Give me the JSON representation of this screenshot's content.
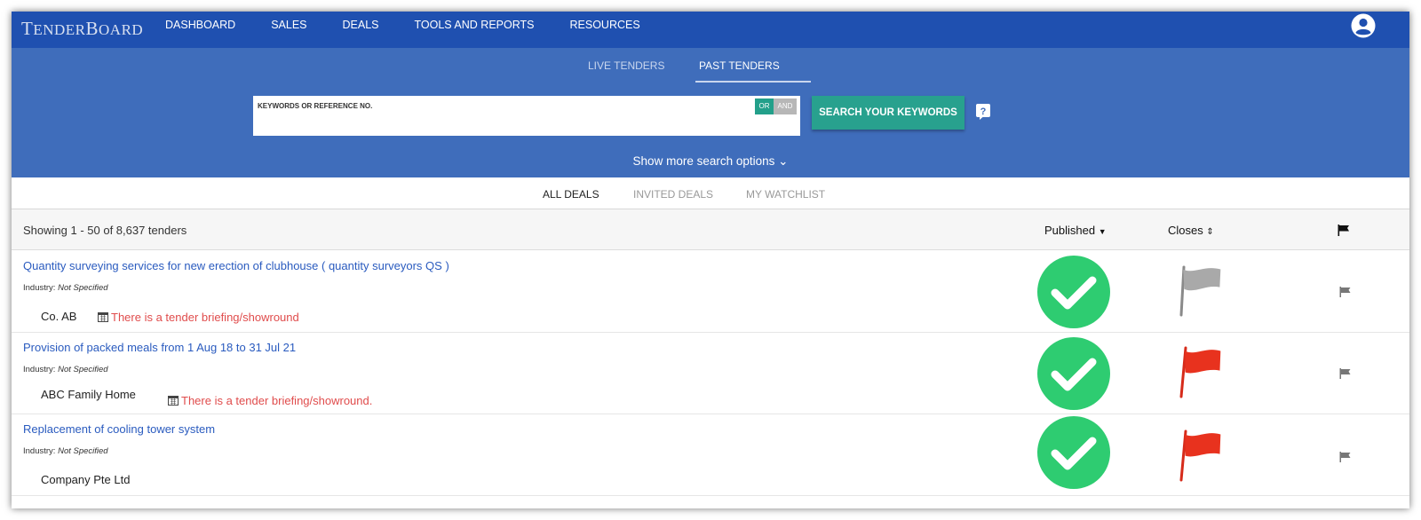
{
  "brand": {
    "logo_first": "T",
    "logo_rest": "ENDER",
    "logo_second": "B",
    "logo_rest2": "OARD"
  },
  "nav": {
    "items": [
      "DASHBOARD",
      "SALES",
      "DEALS",
      "TOOLS AND REPORTS",
      "RESOURCES"
    ]
  },
  "sub_tabs": {
    "live": "LIVE TENDERS",
    "past": "PAST TENDERS",
    "active": "past"
  },
  "search": {
    "label": "KEYWORDS OR REFERENCE NO.",
    "value": "",
    "toggle_or": "OR",
    "toggle_and": "AND",
    "button": "SEARCH YOUR KEYWORDS",
    "more_options": "Show more search options ⌄"
  },
  "deal_tabs": {
    "all": "ALL DEALS",
    "invited": "INVITED DEALS",
    "watchlist": "MY WATCHLIST",
    "active": "all"
  },
  "results": {
    "showing": "Showing 1 - 50 of 8,637 tenders",
    "published_header": "Published",
    "closes_header": "Closes",
    "rows": [
      {
        "title": "Quantity surveying services for new erection of clubhouse ( quantity surveyors QS )",
        "industry_label": "Industry:",
        "industry_value": "Not Specified",
        "company": "Co. AB",
        "briefing": "There is a tender briefing/showround",
        "flag_status": "grey"
      },
      {
        "title": "Provision of packed meals from 1 Aug 18 to 31 Jul 21",
        "industry_label": "Industry:",
        "industry_value": "Not Specified",
        "company": "ABC Family Home",
        "briefing": "There is a tender briefing/showround.",
        "flag_status": "red"
      },
      {
        "title": "Replacement of cooling tower system",
        "industry_label": "Industry:",
        "industry_value": "Not Specified",
        "company": "Company Pte Ltd",
        "briefing": "",
        "flag_status": "red"
      }
    ]
  },
  "colors": {
    "nav_bg": "#1f50b0",
    "band_bg": "#3f6dbb",
    "accent_teal": "#28a18e",
    "link_blue": "#2a5bbf",
    "briefing_red": "#e04c4c",
    "check_green": "#2ecc71",
    "flag_red": "#e8321e",
    "flag_grey": "#a9a9a9"
  }
}
